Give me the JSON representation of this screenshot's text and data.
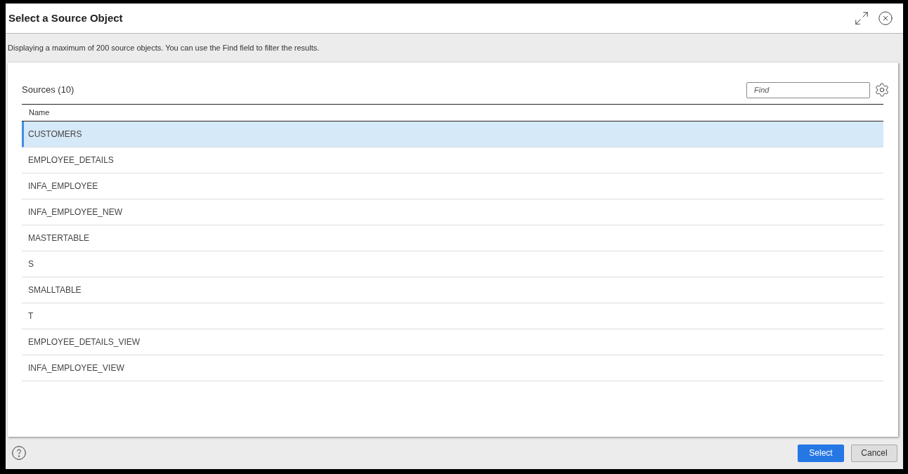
{
  "dialog": {
    "title": "Select a Source Object"
  },
  "info_text": "Displaying a maximum of 200 source objects. You can use the Find field to filter the results.",
  "sources": {
    "title": "Sources (10)",
    "search": {
      "placeholder": "Find"
    },
    "columns": [
      "Name"
    ],
    "rows": [
      {
        "name": "CUSTOMERS",
        "selected": true
      },
      {
        "name": "EMPLOYEE_DETAILS",
        "selected": false
      },
      {
        "name": "INFA_EMPLOYEE",
        "selected": false
      },
      {
        "name": "INFA_EMPLOYEE_NEW",
        "selected": false
      },
      {
        "name": "MASTERTABLE",
        "selected": false
      },
      {
        "name": "S",
        "selected": false
      },
      {
        "name": "SMALLTABLE",
        "selected": false
      },
      {
        "name": "T",
        "selected": false
      },
      {
        "name": "EMPLOYEE_DETAILS_VIEW",
        "selected": false
      },
      {
        "name": "INFA_EMPLOYEE_VIEW",
        "selected": false
      }
    ]
  },
  "buttons": [
    {
      "label": "Select",
      "kind": "primary"
    },
    {
      "label": "Cancel",
      "kind": "secondary"
    }
  ]
}
